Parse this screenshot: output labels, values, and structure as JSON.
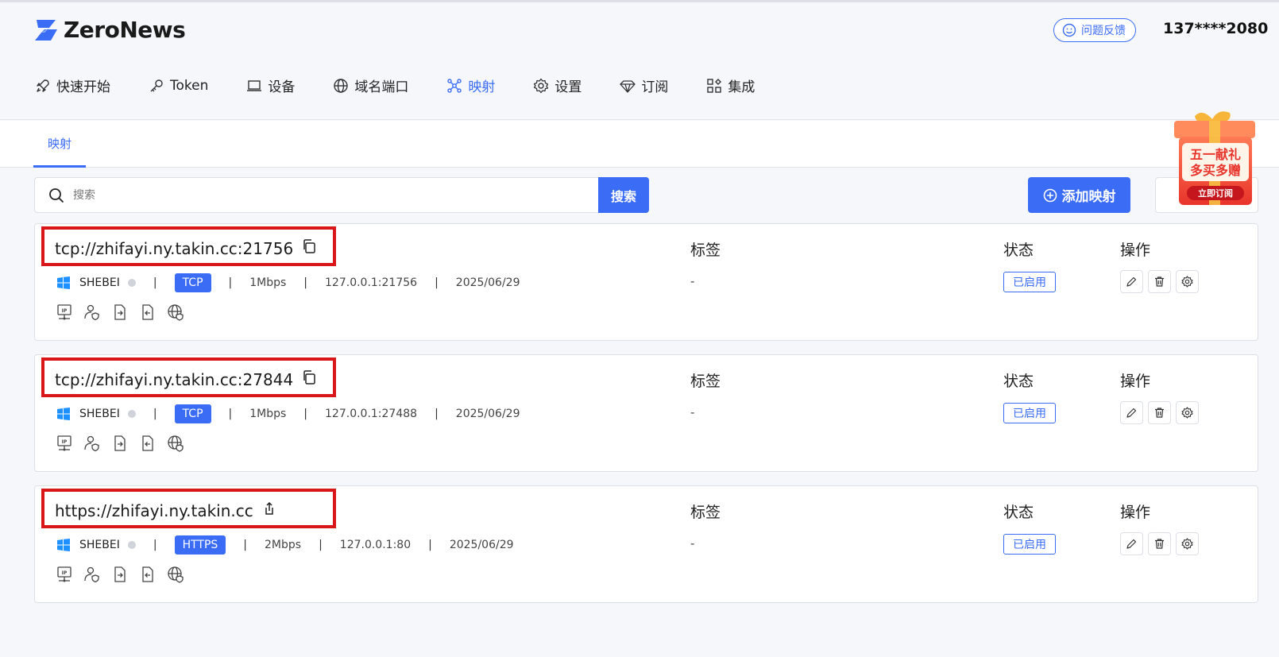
{
  "app": {
    "name": "ZeroNews"
  },
  "header": {
    "feedback_label": "问题反馈",
    "user_phone": "137****2080"
  },
  "nav": [
    {
      "label": "快速开始",
      "icon": "rocket-icon"
    },
    {
      "label": "Token",
      "icon": "key-icon"
    },
    {
      "label": "设备",
      "icon": "laptop-icon"
    },
    {
      "label": "域名端口",
      "icon": "globe-icon"
    },
    {
      "label": "映射",
      "icon": "mapping-icon",
      "active": true
    },
    {
      "label": "设置",
      "icon": "gear-icon"
    },
    {
      "label": "订阅",
      "icon": "diamond-icon"
    },
    {
      "label": "集成",
      "icon": "apps-icon"
    }
  ],
  "subtabs": [
    {
      "label": "映射",
      "active": true
    }
  ],
  "search": {
    "placeholder": "搜索",
    "button_label": "搜索"
  },
  "toolbar": {
    "add_label": "添加映射"
  },
  "promo": {
    "line1": "五一献礼",
    "line2": "多买多赠",
    "cta": "立即订阅"
  },
  "columns": {
    "tags": "标签",
    "status": "状态",
    "actions": "操作"
  },
  "mappings": [
    {
      "url": "tcp://zhifayi.ny.takin.cc:21756",
      "url_action_icon": "copy-icon",
      "device": "SHEBEI",
      "protocol": "TCP",
      "bandwidth": "1Mbps",
      "local": "127.0.0.1:21756",
      "date": "2025/06/29",
      "tags": "-",
      "status": "已启用"
    },
    {
      "url": "tcp://zhifayi.ny.takin.cc:27844",
      "url_action_icon": "copy-icon",
      "device": "SHEBEI",
      "protocol": "TCP",
      "bandwidth": "1Mbps",
      "local": "127.0.0.1:27488",
      "date": "2025/06/29",
      "tags": "-",
      "status": "已启用"
    },
    {
      "url": "https://zhifayi.ny.takin.cc",
      "url_action_icon": "open-link-icon",
      "device": "SHEBEI",
      "protocol": "HTTPS",
      "bandwidth": "2Mbps",
      "local": "127.0.0.1:80",
      "date": "2025/06/29",
      "tags": "-",
      "status": "已启用"
    }
  ],
  "colors": {
    "accent": "#3b6cf6",
    "highlight_box": "#d9171b",
    "promo_red": "#e8342b"
  }
}
